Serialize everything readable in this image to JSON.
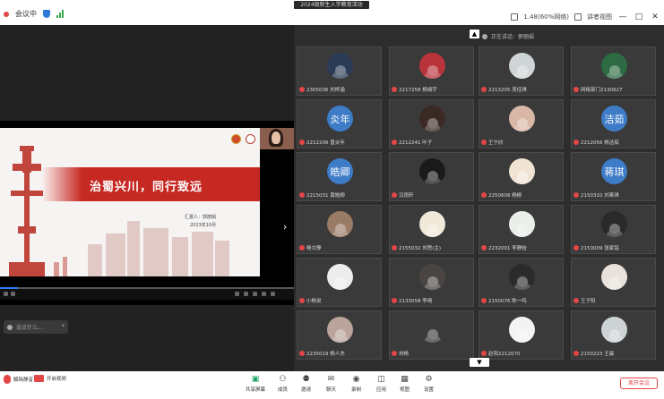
{
  "titlebar": {
    "app_name": "会议中",
    "window_title": "2024级新生入学教育活动",
    "net_info": "1.48(60%网络)",
    "layout_label": "讲者视图",
    "minimize": "—",
    "maximize": "□",
    "close": "✕"
  },
  "slide": {
    "title": "治蜀兴川，同行致远",
    "reporter": "汇报人：郭丽娟",
    "date": "2023年10月"
  },
  "chat": {
    "placeholder": "说点什么..."
  },
  "gallery": {
    "header": "正在讲话：郭丽娟",
    "tiles": [
      {
        "name": "2305036 刘梓涵",
        "avatar": "photo",
        "color": "#2b3b55"
      },
      {
        "name": "2217258 杨靖宇",
        "avatar": "photo",
        "color": "#b9343a"
      },
      {
        "name": "2213205 吴佳琪",
        "avatar": "photo",
        "color": "#cfd4d6"
      },
      {
        "name": "网络部门2130927",
        "avatar": "photo",
        "color": "#2e6b44"
      },
      {
        "name": "2212206 曾炎年",
        "avatar": "炎年",
        "color": "#3e7cc8"
      },
      {
        "name": "2212241 叶子",
        "avatar": "photo",
        "color": "#3b2a23"
      },
      {
        "name": "王宁欣",
        "avatar": "photo",
        "color": "#d8b7a6"
      },
      {
        "name": "2212056 杨洁茹",
        "avatar": "洁茹",
        "color": "#3e7cc8"
      },
      {
        "name": "2215031 黄皓卿",
        "avatar": "皓卿",
        "color": "#3e7cc8"
      },
      {
        "name": "汉雨轩",
        "avatar": "photo",
        "color": "#1a1a1a"
      },
      {
        "name": "2250608 杨柳",
        "avatar": "photo",
        "color": "#f1e3d4"
      },
      {
        "name": "2150310 刘蒋琪",
        "avatar": "蒋琪",
        "color": "#3e7cc8"
      },
      {
        "name": "杨文静",
        "avatar": "photo",
        "color": "#9a7b66"
      },
      {
        "name": "2155032 刘思(主)",
        "avatar": "photo",
        "color": "#f0e8d8"
      },
      {
        "name": "2232001 李静怡",
        "avatar": "photo",
        "color": "#e9efe8"
      },
      {
        "name": "2150009 张家铭",
        "avatar": "photo",
        "color": "#2a2a2a"
      },
      {
        "name": "小杨说",
        "avatar": "photo",
        "color": "#ececec"
      },
      {
        "name": "2133058 李晴",
        "avatar": "photo",
        "color": "#4a4542"
      },
      {
        "name": "2150076 陈一鸣",
        "avatar": "photo",
        "color": "#2b2b2b"
      },
      {
        "name": "王子阳",
        "avatar": "photo",
        "color": "#e9e2dc"
      },
      {
        "name": "2235019 杨人杰",
        "avatar": "photo",
        "color": "#bba49c"
      },
      {
        "name": "刘畅",
        "avatar": "photo",
        "color": "#3a3a3a"
      },
      {
        "name": "赵阳2212070",
        "avatar": "photo",
        "color": "#f3f3f3"
      },
      {
        "name": "2150223 王晨",
        "avatar": "photo",
        "color": "#cdd2d4"
      }
    ]
  },
  "toolbar": {
    "mic": "解除静音",
    "camera": "开启视频",
    "items": [
      "共享屏幕",
      "成员",
      "邀请",
      "聊天",
      "录制",
      "应用",
      "视图",
      "设置"
    ],
    "end": "离开会议"
  }
}
